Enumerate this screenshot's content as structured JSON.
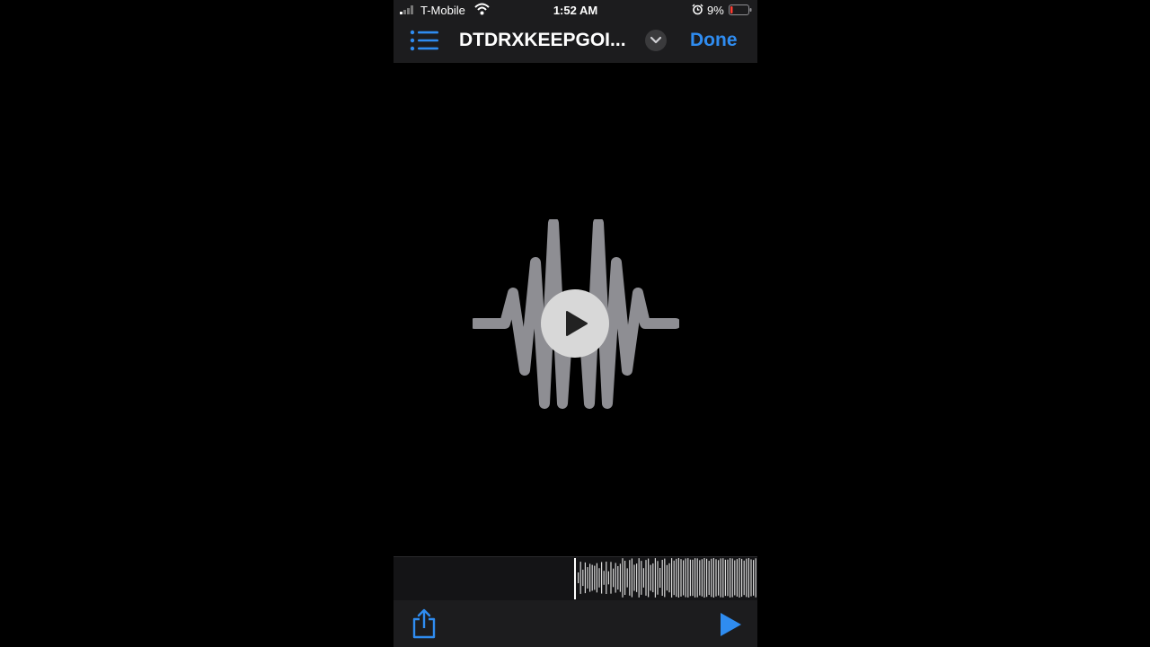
{
  "status_bar": {
    "carrier": "T-Mobile",
    "time": "1:52 AM",
    "battery": "9%",
    "icons": [
      "signal-icon",
      "wifi-icon",
      "alarm-icon",
      "battery-icon"
    ]
  },
  "nav": {
    "title": "DTDRXKEEPGOI...",
    "done_label": "Done",
    "icons": [
      "list-icon",
      "chevron-down-icon"
    ]
  },
  "player": {
    "icons": [
      "waveform-artwork-icon",
      "play-icon"
    ]
  },
  "toolbar": {
    "icons": [
      "share-icon",
      "play-icon"
    ]
  },
  "colors": {
    "accent": "#2f8cf0",
    "bar_bg": "#1c1c1e",
    "artwork": "#8e8e93",
    "battery_low": "#ff3b30"
  }
}
